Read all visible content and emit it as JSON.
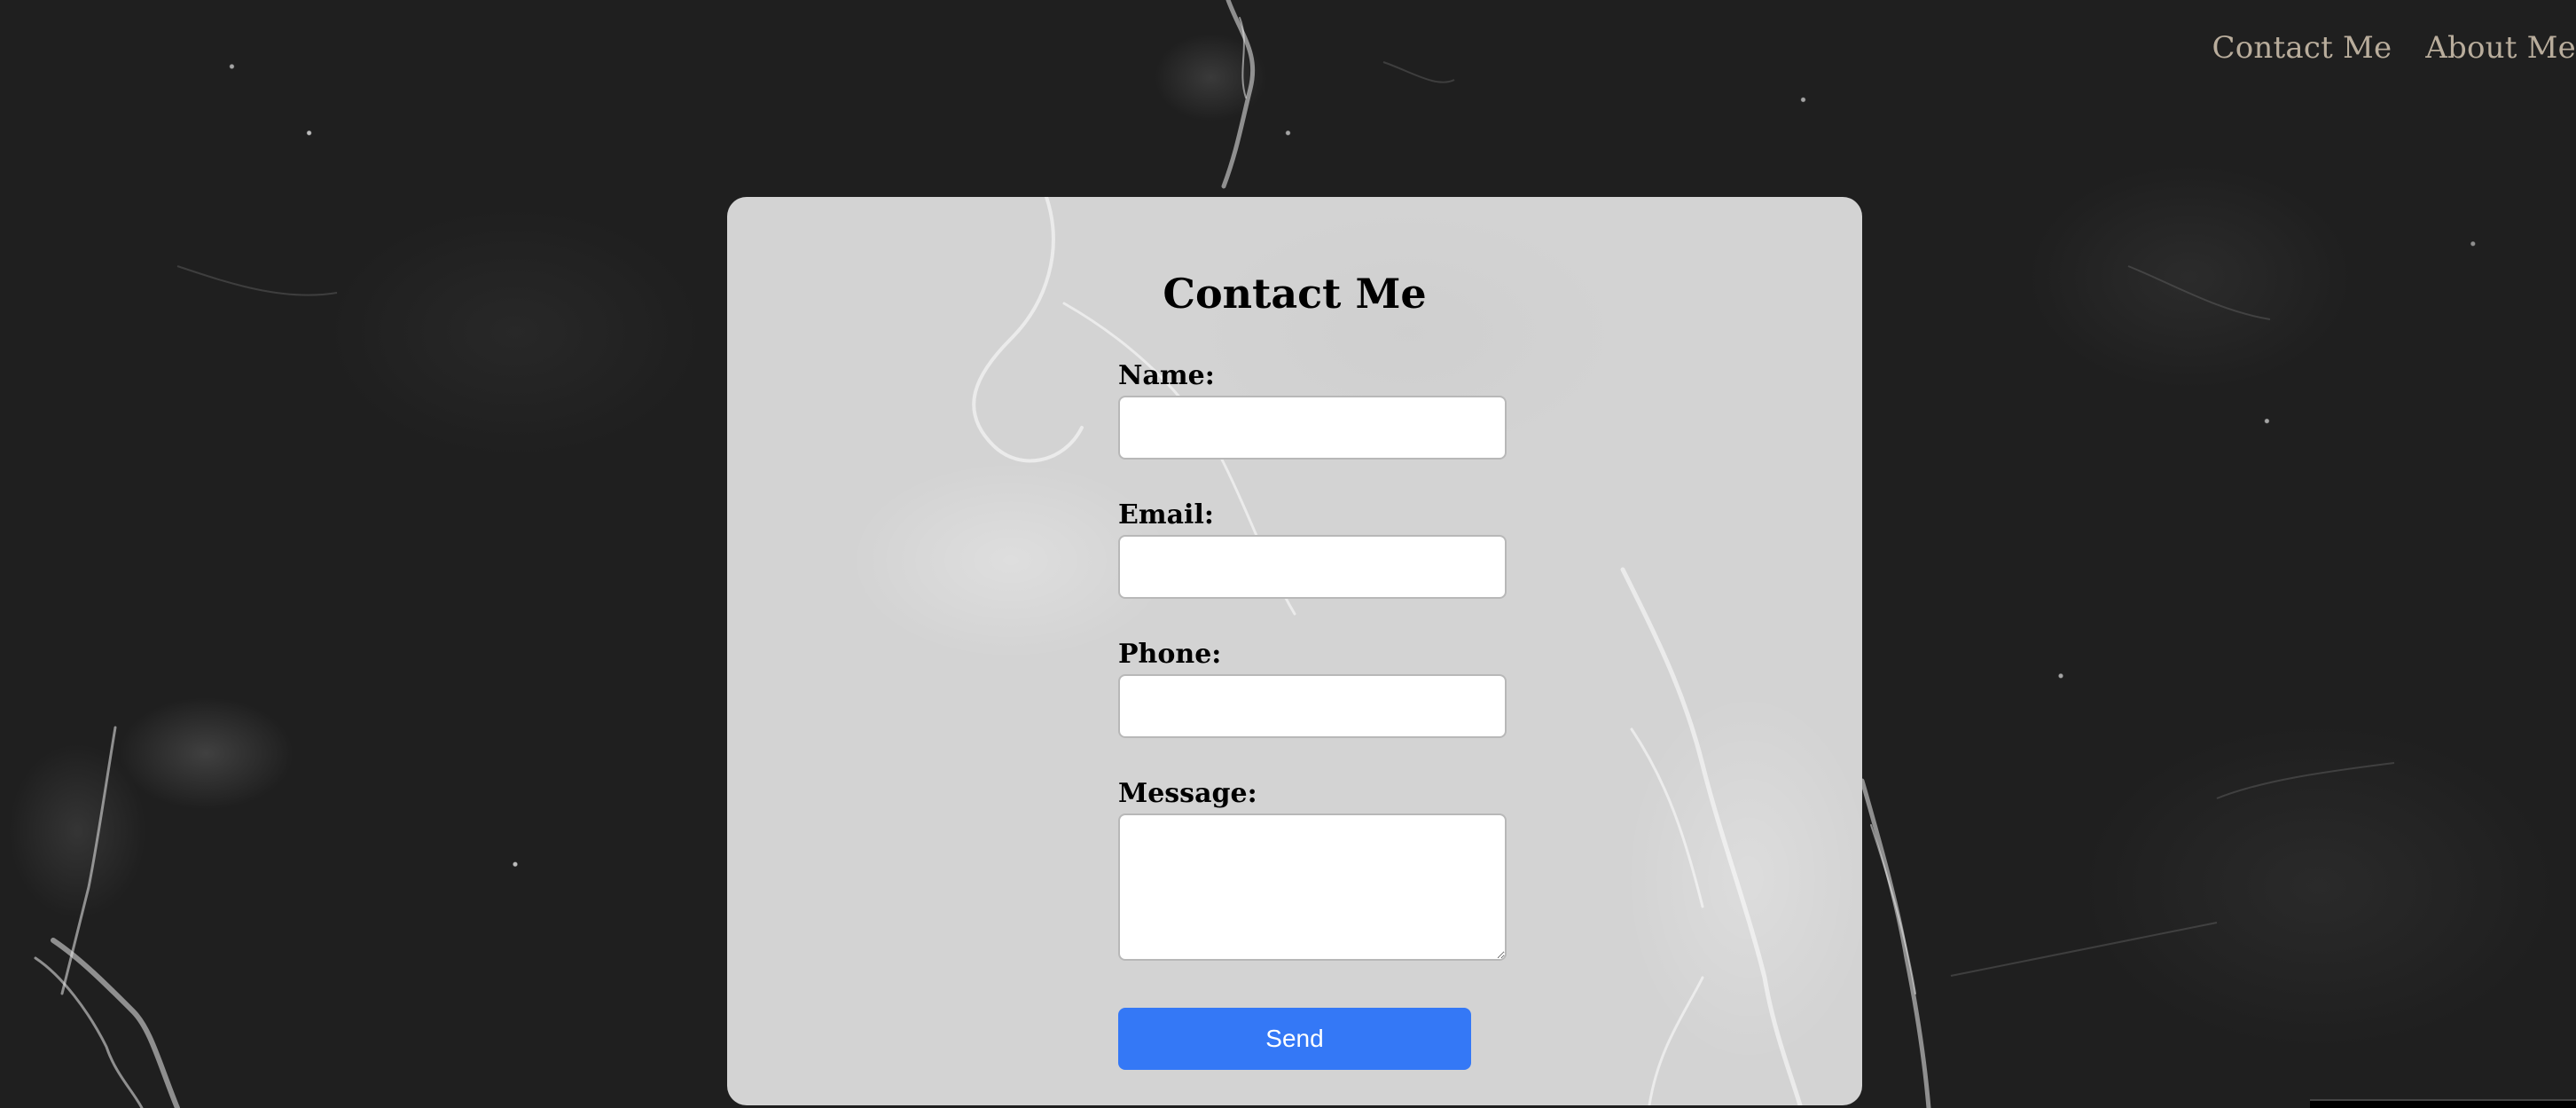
{
  "nav": {
    "items": [
      {
        "label": "Contact Me"
      },
      {
        "label": "About Me"
      }
    ]
  },
  "form": {
    "title": "Contact Me",
    "fields": {
      "name": {
        "label": "Name:",
        "value": ""
      },
      "email": {
        "label": "Email:",
        "value": ""
      },
      "phone": {
        "label": "Phone:",
        "value": ""
      },
      "message": {
        "label": "Message:",
        "value": ""
      }
    },
    "submit_label": "Send"
  },
  "colors": {
    "background": "#1f1f1f",
    "card": "#d3d3d3",
    "nav_text": "#b9ad9c",
    "button": "#3478f6",
    "button_text": "#ffffff"
  }
}
